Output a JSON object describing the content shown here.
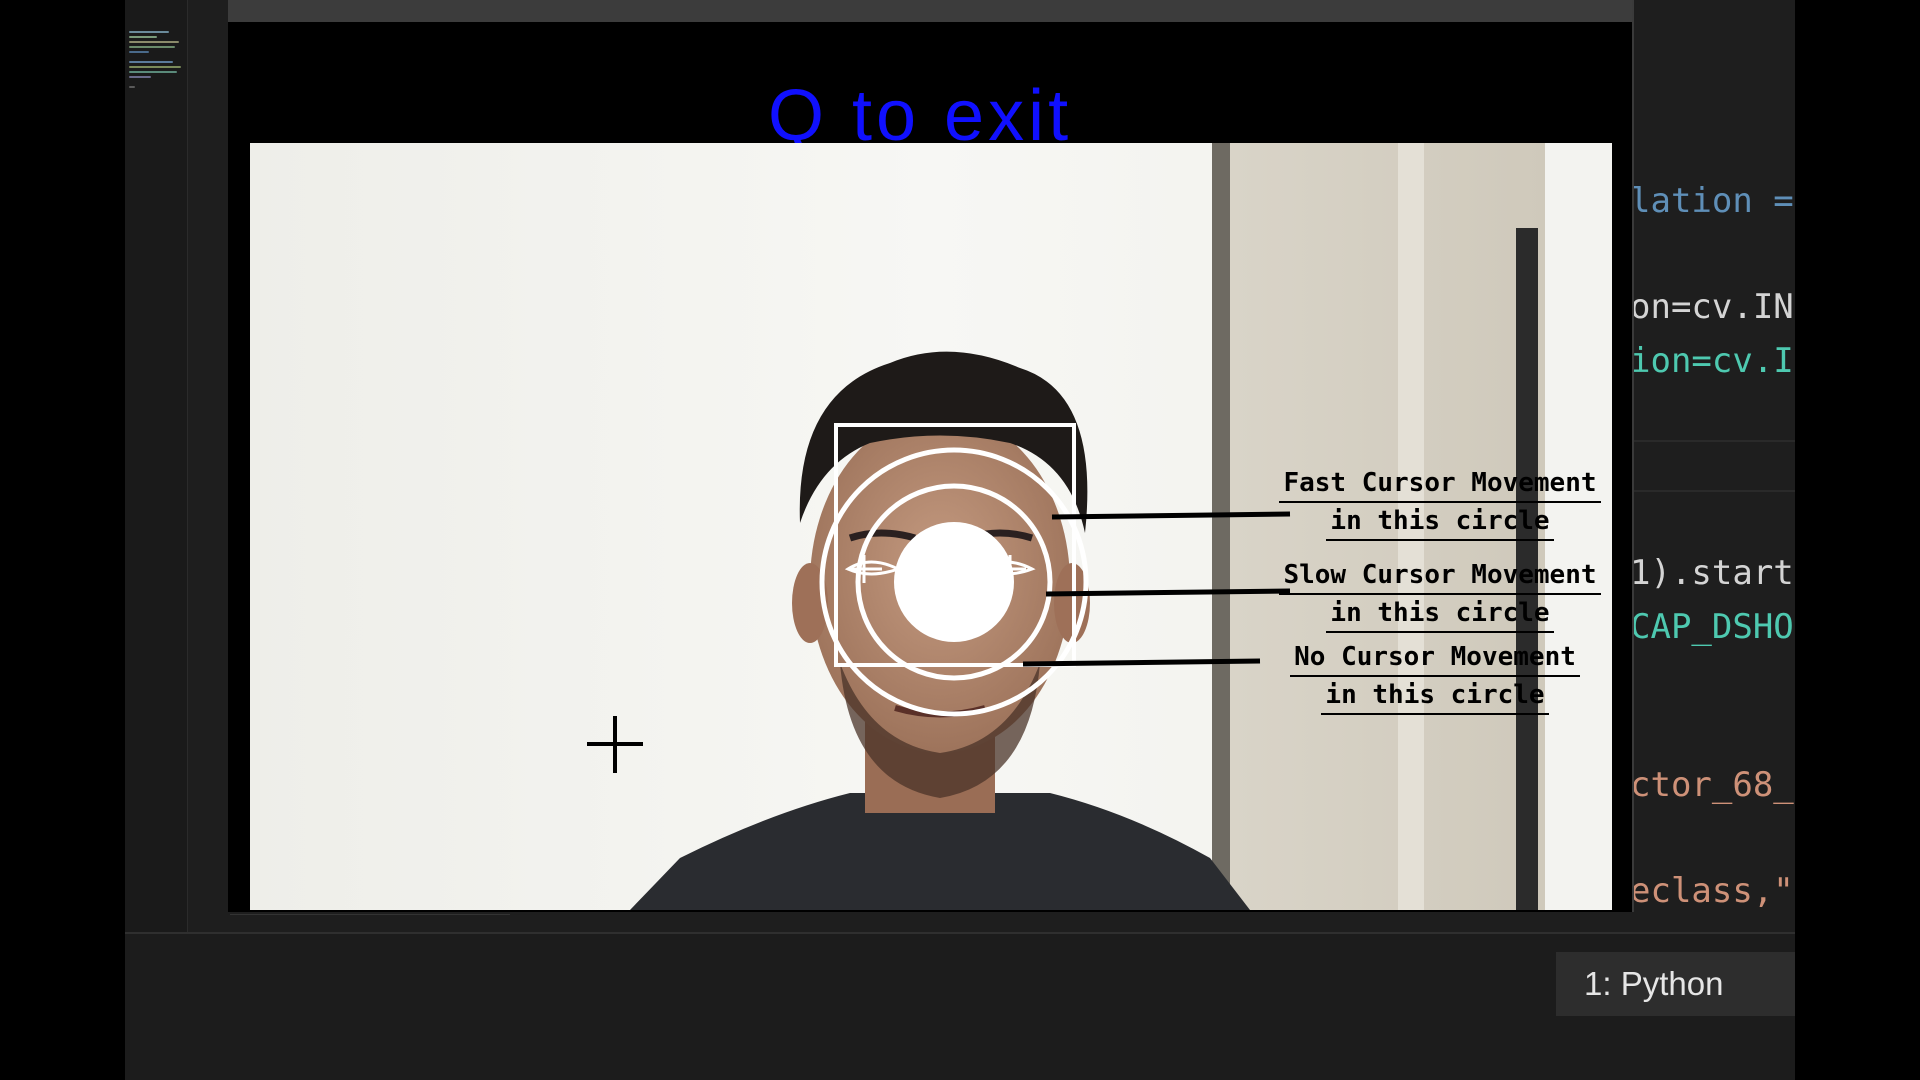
{
  "editor": {
    "code_lines": [
      {
        "text": "lation =",
        "color": "#5f8fb8"
      },
      {
        "text": "on=cv.IN",
        "color": "#d4d4d4"
      },
      {
        "text": "ion=cv.I",
        "color": "#4ec9b0"
      },
      {
        "text": "1).start",
        "color": "#d4d4d4"
      },
      {
        "text": "CAP_DSHO",
        "color": "#4ec9b0"
      },
      {
        "text": "ctor_68_",
        "color": "#ce9178"
      },
      {
        "text": "eclass,\"",
        "color": "#ce9178"
      }
    ]
  },
  "terminal": {
    "tab_label": "1: Python"
  },
  "cv_window": {
    "caption": "Q to exit",
    "caption_color": "#1010ff"
  },
  "annotations": [
    {
      "line1": "Fast Cursor Movement",
      "line2": "in this circle"
    },
    {
      "line1": "Slow Cursor Movement",
      "line2": "in this circle"
    },
    {
      "line1": "No Cursor Movement",
      "line2": "in this circle"
    }
  ]
}
